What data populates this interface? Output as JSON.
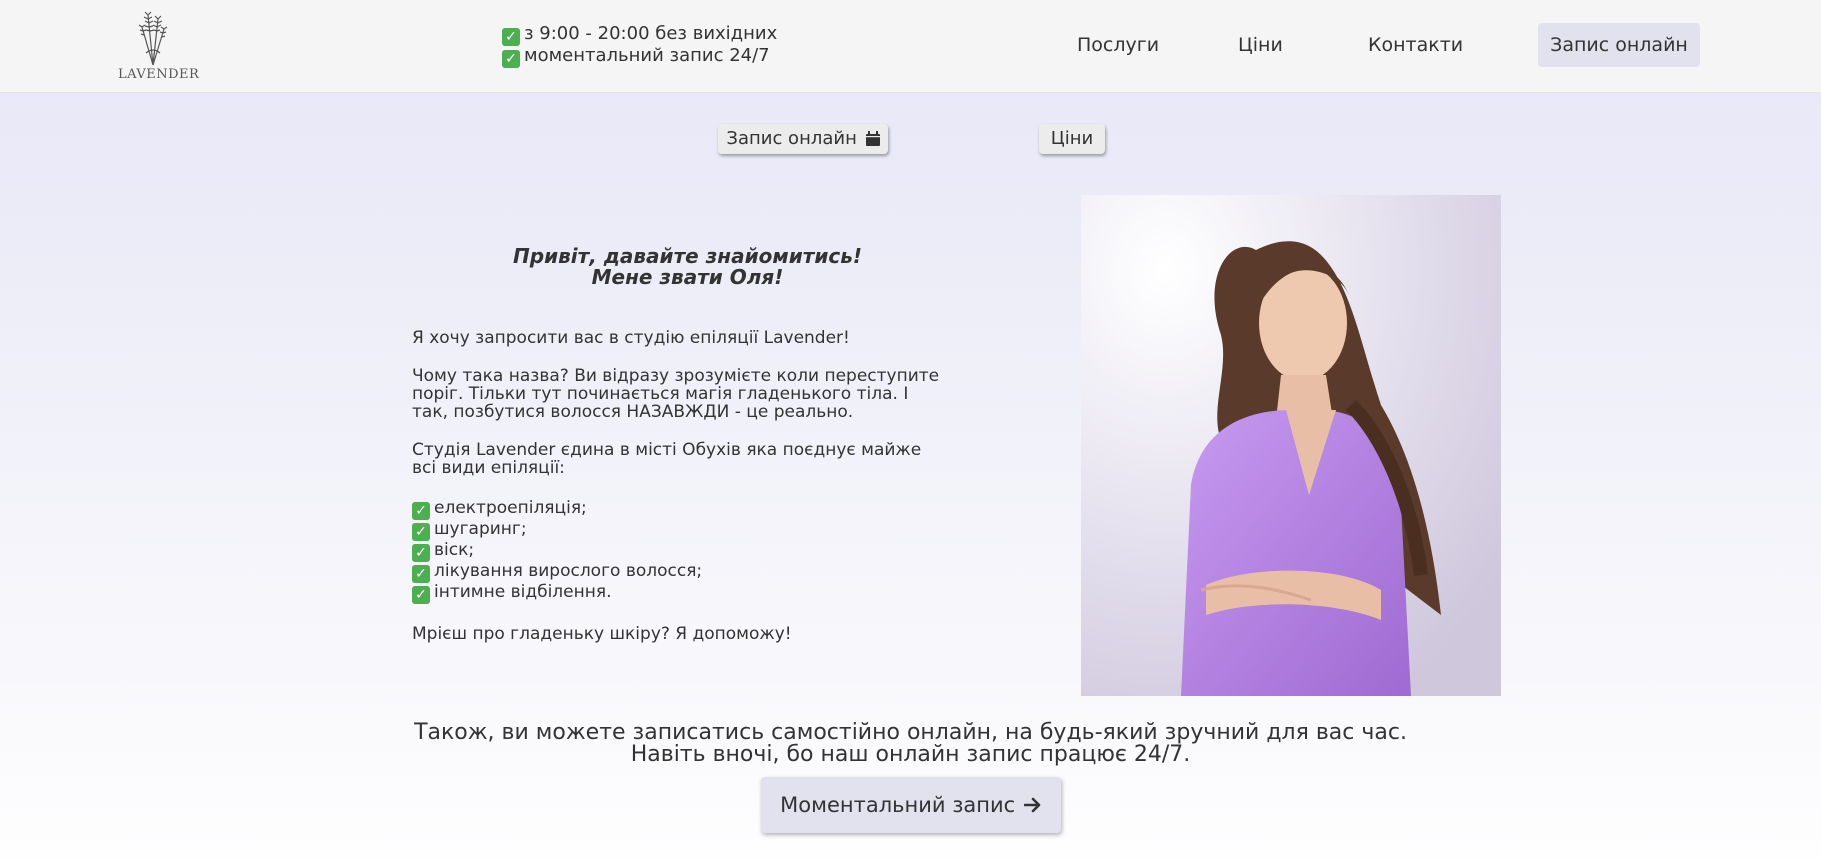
{
  "header": {
    "logo_text": "LAVENDER",
    "hours_line": "з 9:00 - 20:00 без вихідних",
    "booking_line": "моментальний запис 24/7",
    "nav": [
      "Послуги",
      "Ціни",
      "Контакти"
    ],
    "cta_label": "Запис онлайн"
  },
  "actions": {
    "book_label": "Запис онлайн",
    "prices_label": "Ціни"
  },
  "intro": {
    "greeting_line1": "Привіт, давайте знайомитись!",
    "greeting_line2": "Мене звати Оля!",
    "p1": "Я хочу запросити вас в студію епіляції Lavender!",
    "p2": "Чому така назва? Ви відразу зрозумієте коли переступите поріг. Тільки тут починається магія гладенького тіла. І так, позбутися волосся НАЗАВЖДИ - це реально.",
    "p3": "Студія Lavender єдина в місті Обухів яка поєднує майже всі види епіляції:",
    "services": [
      "електроепіляція;",
      "шугаринг;",
      "віск;",
      "лікування вирослого волосся;",
      "інтимне відбілення."
    ],
    "closing": "Мрієш про гладеньку шкіру? Я допоможу!"
  },
  "cta": {
    "line1": "Також, ви можете записатись самостійно онлайн, на будь-який зручний для вас час.",
    "line2": "Навіть вночі, бо наш онлайн запис працює 24/7.",
    "button_label": "Моментальний запис"
  },
  "colors": {
    "check_green": "#4caf50",
    "uniform_purple": "#b27fe0",
    "button_bg": "#e2e2ee"
  },
  "icons": {
    "check": "check-mark-icon",
    "calendar": "calendar-icon",
    "arrow": "arrow-right-icon"
  }
}
